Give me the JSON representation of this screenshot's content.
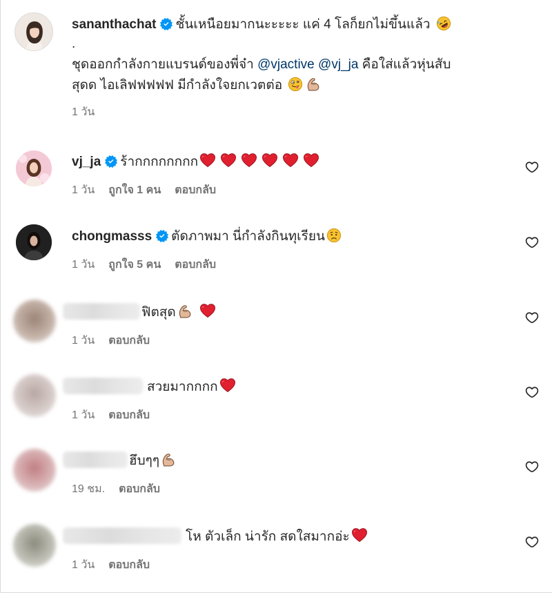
{
  "post": {
    "username": "sanantha­chat",
    "caption_line1": "ชั้นเหนือยมากนะะะะะ แค่ 4 โลก็ยกไม่ขึ้นแล้ว",
    "caption_dot": ".",
    "caption_line3_pre": "ชุดออกกำลังกายแบรนด์ของพี่จ๋า ",
    "mention1": "@vjactive",
    "mention2": "@vj_ja",
    "caption_line3_post": " คือใส่แล้วหุ่นสับ",
    "caption_line4": "สุดด ไอเลิฟฟฟฟฟ มีกำลังใจยกเวตต่อ",
    "time": "1 วัน"
  },
  "comments": [
    {
      "username": "vj_ja",
      "text": "ร้ากกกกกกกก",
      "time": "1 วัน",
      "likes": "ถูกใจ 1 คน",
      "reply": "ตอบกลับ"
    },
    {
      "username": "chongmasss",
      "text": "ตัดภาพมา นี่กำลังกินทุเรียน",
      "time": "1 วัน",
      "likes": "ถูกใจ 5 คน",
      "reply": "ตอบกลับ"
    },
    {
      "text": "ฟิตสุด",
      "time": "1 วัน",
      "reply": "ตอบกลับ"
    },
    {
      "text": "สวยมากกกก",
      "time": "1 วัน",
      "reply": "ตอบกลับ"
    },
    {
      "text": "ฮึบๆๆ",
      "time": "19 ชม.",
      "reply": "ตอบกลับ"
    },
    {
      "text": "โห ตัวเล็ก น่ารัก สดใสมากอ่ะ",
      "time": "1 วัน",
      "reply": "ตอบกลับ"
    }
  ],
  "icons": {
    "verified": "verified-badge-icon",
    "like": "heart-outline-icon",
    "red_heart": "red-heart-emoji",
    "flexed_bicep": "flexed-biceps-emoji",
    "rofl": "rolling-laughing-emoji",
    "zany": "zany-face-emoji",
    "sad": "sad-face-emoji"
  },
  "colors": {
    "verified": "#0095f6",
    "mention": "#00376b",
    "meta": "#737373",
    "heart": "#e0202f"
  }
}
